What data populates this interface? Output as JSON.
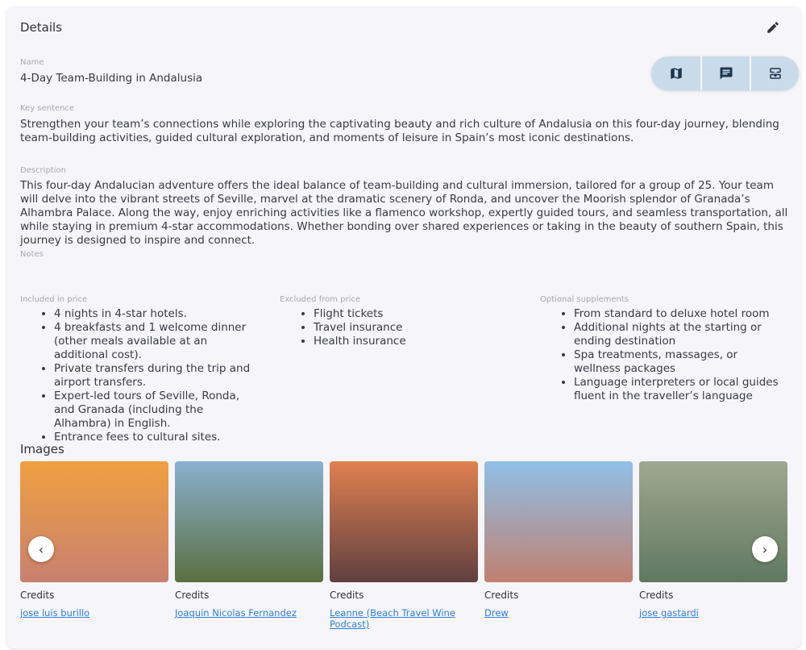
{
  "title": "Details",
  "actions": {
    "edit_icon": "pencil-icon",
    "buttons": [
      "map-icon",
      "comment-icon",
      "inbox-icon"
    ]
  },
  "name": {
    "label": "Name",
    "value": "4-Day Team-Building in Andalusia"
  },
  "key_sentence": {
    "label": "Key sentence",
    "value": "Strengthen your team’s connections while exploring the captivating beauty and rich culture of Andalusia on this four-day journey, blending team-building activities, guided cultural exploration, and moments of leisure in Spain’s most iconic destinations."
  },
  "description": {
    "label": "Description",
    "value": "This four-day Andalucian adventure offers the ideal balance of team-building and cultural immersion, tailored for a group of 25. Your team will delve into the vibrant streets of Seville, marvel at the dramatic scenery of Ronda, and uncover the Moorish splendor of Granada’s Alhambra Palace. Along the way, enjoy enriching activities like a flamenco workshop, expertly guided tours, and seamless transportation, all while staying in premium 4-star accommodations. Whether bonding over shared experiences or taking in the beauty of southern Spain, this journey is designed to inspire and connect."
  },
  "notes": {
    "label": "Notes",
    "value": ""
  },
  "included": {
    "label": "Included in price",
    "items": [
      "4 nights in 4-star hotels.",
      "4 breakfasts and 1 welcome dinner (other meals available at an additional cost).",
      "Private transfers during the trip and airport transfers.",
      "Expert-led tours of Seville, Ronda, and Granada (including the Alhambra) in English.",
      "Entrance fees to cultural sites."
    ]
  },
  "excluded": {
    "label": "Excluded from price",
    "items": [
      "Flight tickets",
      "Travel insurance",
      "Health insurance"
    ]
  },
  "optional": {
    "label": "Optional supplements",
    "items": [
      "From standard to deluxe hotel room",
      "Additional nights at the starting or ending destination",
      "Spa treatments, massages, or wellness packages",
      "Language interpreters or local guides fluent in the traveller’s language"
    ]
  },
  "images": {
    "title": "Images",
    "credits_label": "Credits",
    "items": [
      {
        "credit": "jose luis burillo",
        "colors": [
          "#f0a040",
          "#c88070"
        ]
      },
      {
        "credit": "Joaquin Nicolas Fernandez",
        "colors": [
          "#8ab0d0",
          "#5a7040"
        ]
      },
      {
        "credit": "Leanne (Beach Travel Wine Podcast)",
        "colors": [
          "#e08050",
          "#604040"
        ]
      },
      {
        "credit": "Drew",
        "colors": [
          "#90c0e8",
          "#c08070"
        ]
      },
      {
        "credit": "jose gastardi",
        "colors": [
          "#a0a890",
          "#607860"
        ]
      }
    ]
  }
}
